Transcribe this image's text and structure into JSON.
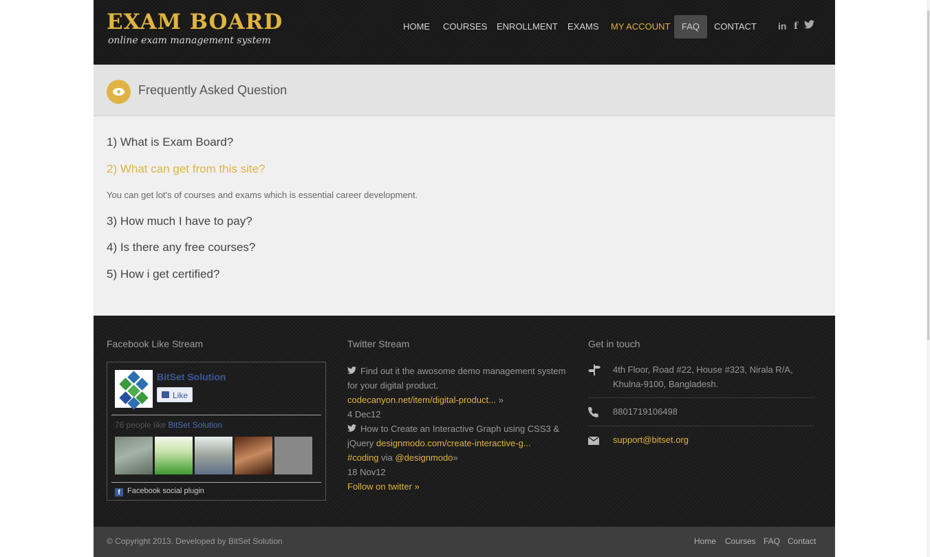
{
  "header": {
    "logo_title": "EXAM BOARD",
    "logo_subtitle": "online exam management system",
    "nav": [
      {
        "label": "HOME"
      },
      {
        "label": "COURSES"
      },
      {
        "label": "ENROLLMENT"
      },
      {
        "label": "EXAMS"
      },
      {
        "label": "MY ACCOUNT"
      },
      {
        "label": "FAQ"
      },
      {
        "label": "CONTACT"
      }
    ],
    "social": {
      "linkedin": "in",
      "facebook": "f",
      "twitter": "twitter-icon"
    }
  },
  "page": {
    "title": "Frequently Asked Question",
    "icon": "eye-icon"
  },
  "faq": [
    {
      "question": "1) What is Exam Board?"
    },
    {
      "question": "2) What can get from this site?",
      "answer": "You can get lot's of courses and exams which is essential career development."
    },
    {
      "question": "3) How much I have to pay?"
    },
    {
      "question": "4) Is there any free courses?"
    },
    {
      "question": "5) How i get certified?"
    }
  ],
  "footer": {
    "facebook": {
      "heading": "Facebook Like Stream",
      "page_name": "BitSet Solution",
      "like_label": "Like",
      "count_prefix": "76 people like",
      "count_name": "BitSet Solution",
      "plugin_label": "Facebook social plugin"
    },
    "twitter": {
      "heading": "Twitter Stream",
      "tweets": [
        {
          "text": "Find out it the awosome demo management system for your digital product.",
          "link": "codecanyon.net/item/digital-product...",
          "date": "4 Dec12"
        },
        {
          "text": "How to Create an Interactive Graph using CSS3 & jQuery",
          "link": "designmodo.com/create-interactive-g...",
          "hashtag": "#coding",
          "via": "via",
          "handle": "@designmodo",
          "date": "18 Nov12"
        }
      ],
      "follow": "Follow on twitter »"
    },
    "contact": {
      "heading": "Get in touch",
      "address": "4th Floor, Road #22, House #323, Nirala R/A, Khulna-9100, Bangladesh.",
      "phone": "8801719106498",
      "email": "support@bitset.org"
    }
  },
  "bottom": {
    "copyright": "© Copyright 2013. Developed by BitSet Solution",
    "links": [
      {
        "label": "Home"
      },
      {
        "label": "Courses"
      },
      {
        "label": "FAQ"
      },
      {
        "label": "Contact"
      }
    ]
  },
  "colors": {
    "accent": "#dfb445",
    "dark": "#1b1b1b",
    "content_bg": "#f0f0f0"
  }
}
